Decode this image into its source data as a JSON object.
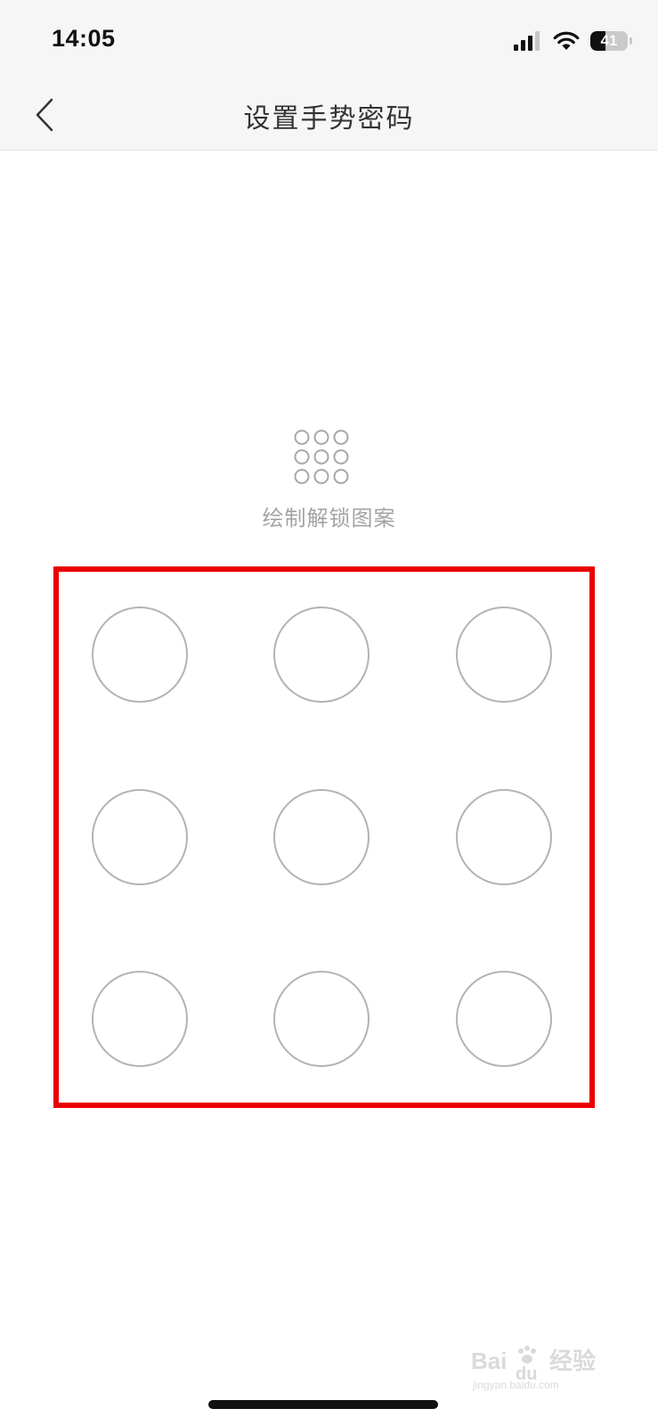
{
  "status_bar": {
    "time": "14:05",
    "battery_level": "41",
    "battery_percent": 41,
    "icons": [
      "signal-icon",
      "wifi-icon",
      "battery-icon"
    ]
  },
  "nav": {
    "back_icon": "chevron-left-icon",
    "title": "设置手势密码"
  },
  "gesture": {
    "preview_icon": "pattern-grid-icon",
    "instruction": "绘制解锁图案",
    "grid_rows": 3,
    "grid_cols": 3,
    "highlight_color": "#ea0000",
    "dot_color": "#b3b3b3"
  },
  "watermark": {
    "text": "Bai du 经验",
    "subtext": "jingyan.baidu.com"
  }
}
